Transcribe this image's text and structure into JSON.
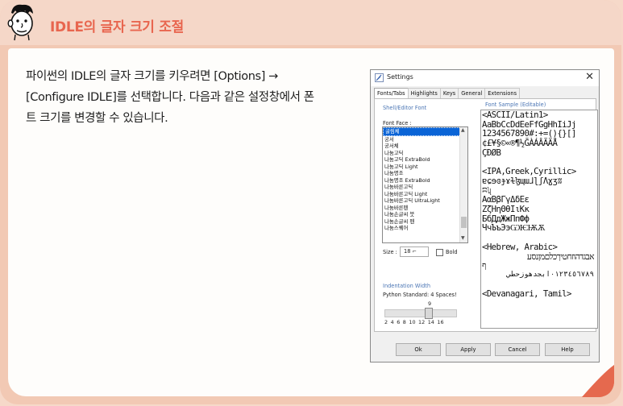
{
  "header": {
    "title": "IDLE의 글자 크기 조절"
  },
  "body": {
    "line1": "파이썬의 IDLE의 글자 크기를 키우려면 [Options] →",
    "line2": "[Configure IDLE]를 선택합니다. 다음과 같은 설정창에서 폰",
    "line3": "트 크기를 변경할 수 있습니다."
  },
  "dialog": {
    "title": "Settings",
    "close": "✕",
    "tabs": [
      "Fonts/Tabs",
      "Highlights",
      "Keys",
      "General",
      "Extensions"
    ],
    "shell_editor_font": "Shell/Editor Font",
    "font_face_label": "Font Face :",
    "fonts": [
      "굴림체",
      "궁서",
      "궁서체",
      "나눔고딕",
      "나눔고딕 ExtraBold",
      "나눔고딕 Light",
      "나눔명조",
      "나눔명조 ExtraBold",
      "나눔바른고딕",
      "나눔바른고딕 Light",
      "나눔바른고딕 UltraLight",
      "나눔바른펜",
      "나눔손글씨 붓",
      "나눔손글씨 펜",
      "나눔스퀘어"
    ],
    "size_label": "Size :",
    "size_value": "18",
    "bold_label": "Bold",
    "indentation_width": "Indentation Width",
    "python_standard": "Python Standard: 4 Spaces!",
    "indent_value": "9",
    "slider_ticks": "2 4 6 8 10 12 14 16",
    "slider_level": 9,
    "font_sample_title": "Font Sample (Editable)",
    "sample_lines": [
      "<ASCII/Latin1>",
      "AaBbCcDdEeFfGgHhIiJj",
      "1234567890#:+=(){}[]",
      "¢£¥§©«®¶½ĞÀÁÂÃÄÅ",
      "ÇÐØB",
      "",
      "<IPA,Greek,Cyrillic>",
      "ɐɕɘɞɟɤɫɮɰɯɺɭʃɅɣʒʬ",
      "ʭʯ",
      "ΑαΒβΓγΔδΕε",
      "ΖζΗηΘθΙιΚκ",
      "БбДдЖжПпФф",
      "ЧчЪъЭэѠѤѬѪ",
      "",
      "<Hebrew, Arabic>"
    ],
    "hebrew_line1": "אבגדהוזחטיךכלםמןנסע",
    "hebrew_line2": "ף",
    "arabic_line": "٠١٢٣٤٥٦٧٨٩ابجدهوزحطي",
    "devanagari_line": "<Devanagari, Tamil>",
    "buttons": [
      "Ok",
      "Apply",
      "Cancel",
      "Help"
    ]
  }
}
